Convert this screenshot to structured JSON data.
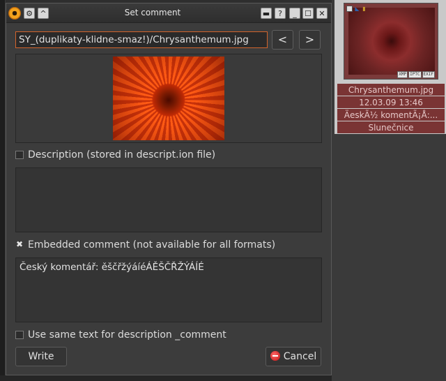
{
  "dialog": {
    "title": "Set comment",
    "titlebar_buttons": [
      "▬",
      "?",
      "_",
      "☐",
      "✕"
    ],
    "filename_value": "SY_(duplikaty-klidne-smaz!)/Chrysanthemum.jpg",
    "prev_label": "<",
    "next_label": ">",
    "description_checkbox_label": "Description (stored in descript.ion file)",
    "description_checked": false,
    "description_text": "",
    "embedded_checkbox_label": "Embedded comment (not available for all formats)",
    "embedded_checked": true,
    "embedded_text": "Český komentář: ěščřžýáíéÁĚŠČŘŽÝÁÍÉ",
    "same_text_checkbox_label": "Use same text for description _comment",
    "same_text_checked": false,
    "write_label": "Write",
    "cancel_label": "Cancel"
  },
  "browser": {
    "thumbnail_badges": [
      "XMP",
      "IPTC",
      "EXIF"
    ],
    "labels": [
      "Chrysanthemum.jpg",
      "12.03.09 13:46",
      "Ä\u001ceskÃ½ komentÃ¡Å\u001b:...",
      "Slunečnice"
    ]
  },
  "colors": {
    "accent_border": "#d2642c",
    "thumb_label_bg": "#7a3434",
    "dialog_bg": "#3c3c3c"
  }
}
